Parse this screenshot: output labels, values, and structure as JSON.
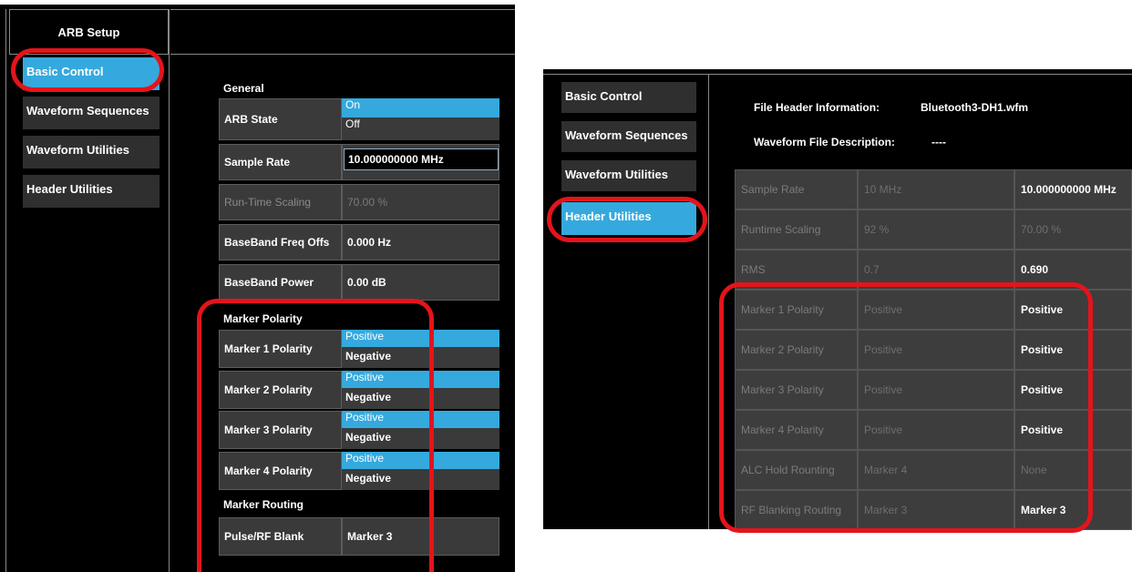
{
  "left": {
    "title": "ARB Setup",
    "nav": [
      "Basic Control",
      "Waveform Sequences",
      "Waveform Utilities",
      "Header Utilities"
    ],
    "general": {
      "heading": "General",
      "arb_state_label": "ARB State",
      "arb_state_options": [
        "On",
        "Off"
      ],
      "sample_rate_label": "Sample Rate",
      "sample_rate_value": "10.000000000 MHz",
      "runtime_scaling_label": "Run-Time Scaling",
      "runtime_scaling_value": "70.00 %",
      "bb_freq_label": "BaseBand Freq Offs",
      "bb_freq_value": "0.000 Hz",
      "bb_power_label": "BaseBand Power",
      "bb_power_value": "0.00 dB"
    },
    "marker_polarity": {
      "heading": "Marker Polarity",
      "rows": [
        {
          "label": "Marker 1 Polarity",
          "on": "Positive",
          "off": "Negative"
        },
        {
          "label": "Marker 2 Polarity",
          "on": "Positive",
          "off": "Negative"
        },
        {
          "label": "Marker 3 Polarity",
          "on": "Positive",
          "off": "Negative"
        },
        {
          "label": "Marker 4 Polarity",
          "on": "Positive",
          "off": "Negative"
        }
      ]
    },
    "marker_routing": {
      "heading": "Marker Routing",
      "pulse_label": "Pulse/RF Blank",
      "pulse_value": "Marker 3"
    }
  },
  "right": {
    "nav": [
      "Basic Control",
      "Waveform Sequences",
      "Waveform Utilities",
      "Header Utilities"
    ],
    "file_header_label": "File Header Information:",
    "file_header_value": "Bluetooth3-DH1.wfm",
    "description_label": "Waveform File Description:",
    "description_value": "----",
    "rows": [
      {
        "label": "Sample Rate",
        "file": "10 MHz",
        "current": "10.000000000 MHz"
      },
      {
        "label": "Runtime Scaling",
        "file": "92 %",
        "current": "70.00 %"
      },
      {
        "label": "RMS",
        "file": "0.7",
        "current": "0.690"
      },
      {
        "label": "Marker 1 Polarity",
        "file": "Positive",
        "current": "Positive"
      },
      {
        "label": "Marker 2 Polarity",
        "file": "Positive",
        "current": "Positive"
      },
      {
        "label": "Marker 3 Polarity",
        "file": "Positive",
        "current": "Positive"
      },
      {
        "label": "Marker 4 Polarity",
        "file": "Positive",
        "current": "Positive"
      },
      {
        "label": "ALC Hold Rounting",
        "file": "Marker 4",
        "current": "None"
      },
      {
        "label": "RF Blanking Routing",
        "file": "Marker 3",
        "current": "Marker 3"
      }
    ]
  },
  "colors": {
    "accent": "#35a9dd",
    "highlight": "#e4141a"
  }
}
